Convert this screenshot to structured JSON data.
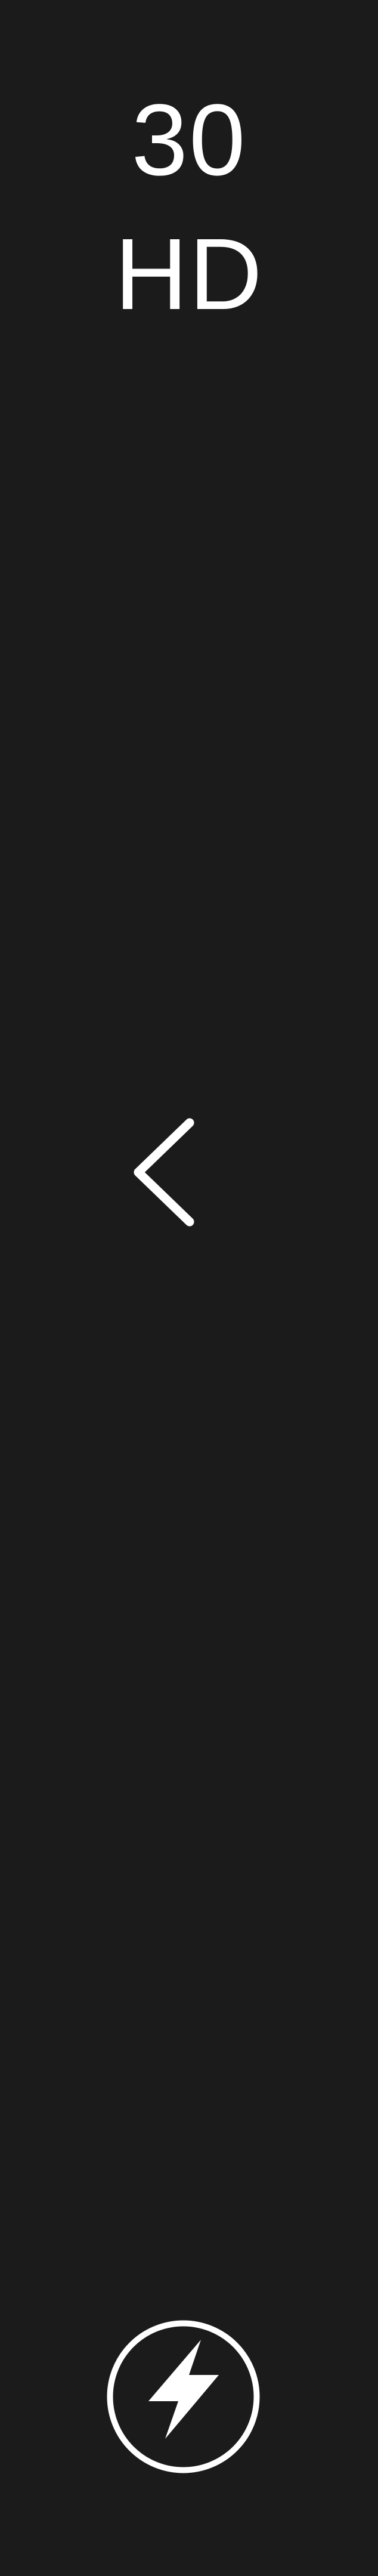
{
  "camera_controls": {
    "frame_rate": "30",
    "resolution": "HD"
  },
  "icons": {
    "back": "chevron-left-icon",
    "flash": "flash-auto-icon"
  },
  "colors": {
    "background": "#1b1b1b",
    "foreground": "#ffffff"
  }
}
